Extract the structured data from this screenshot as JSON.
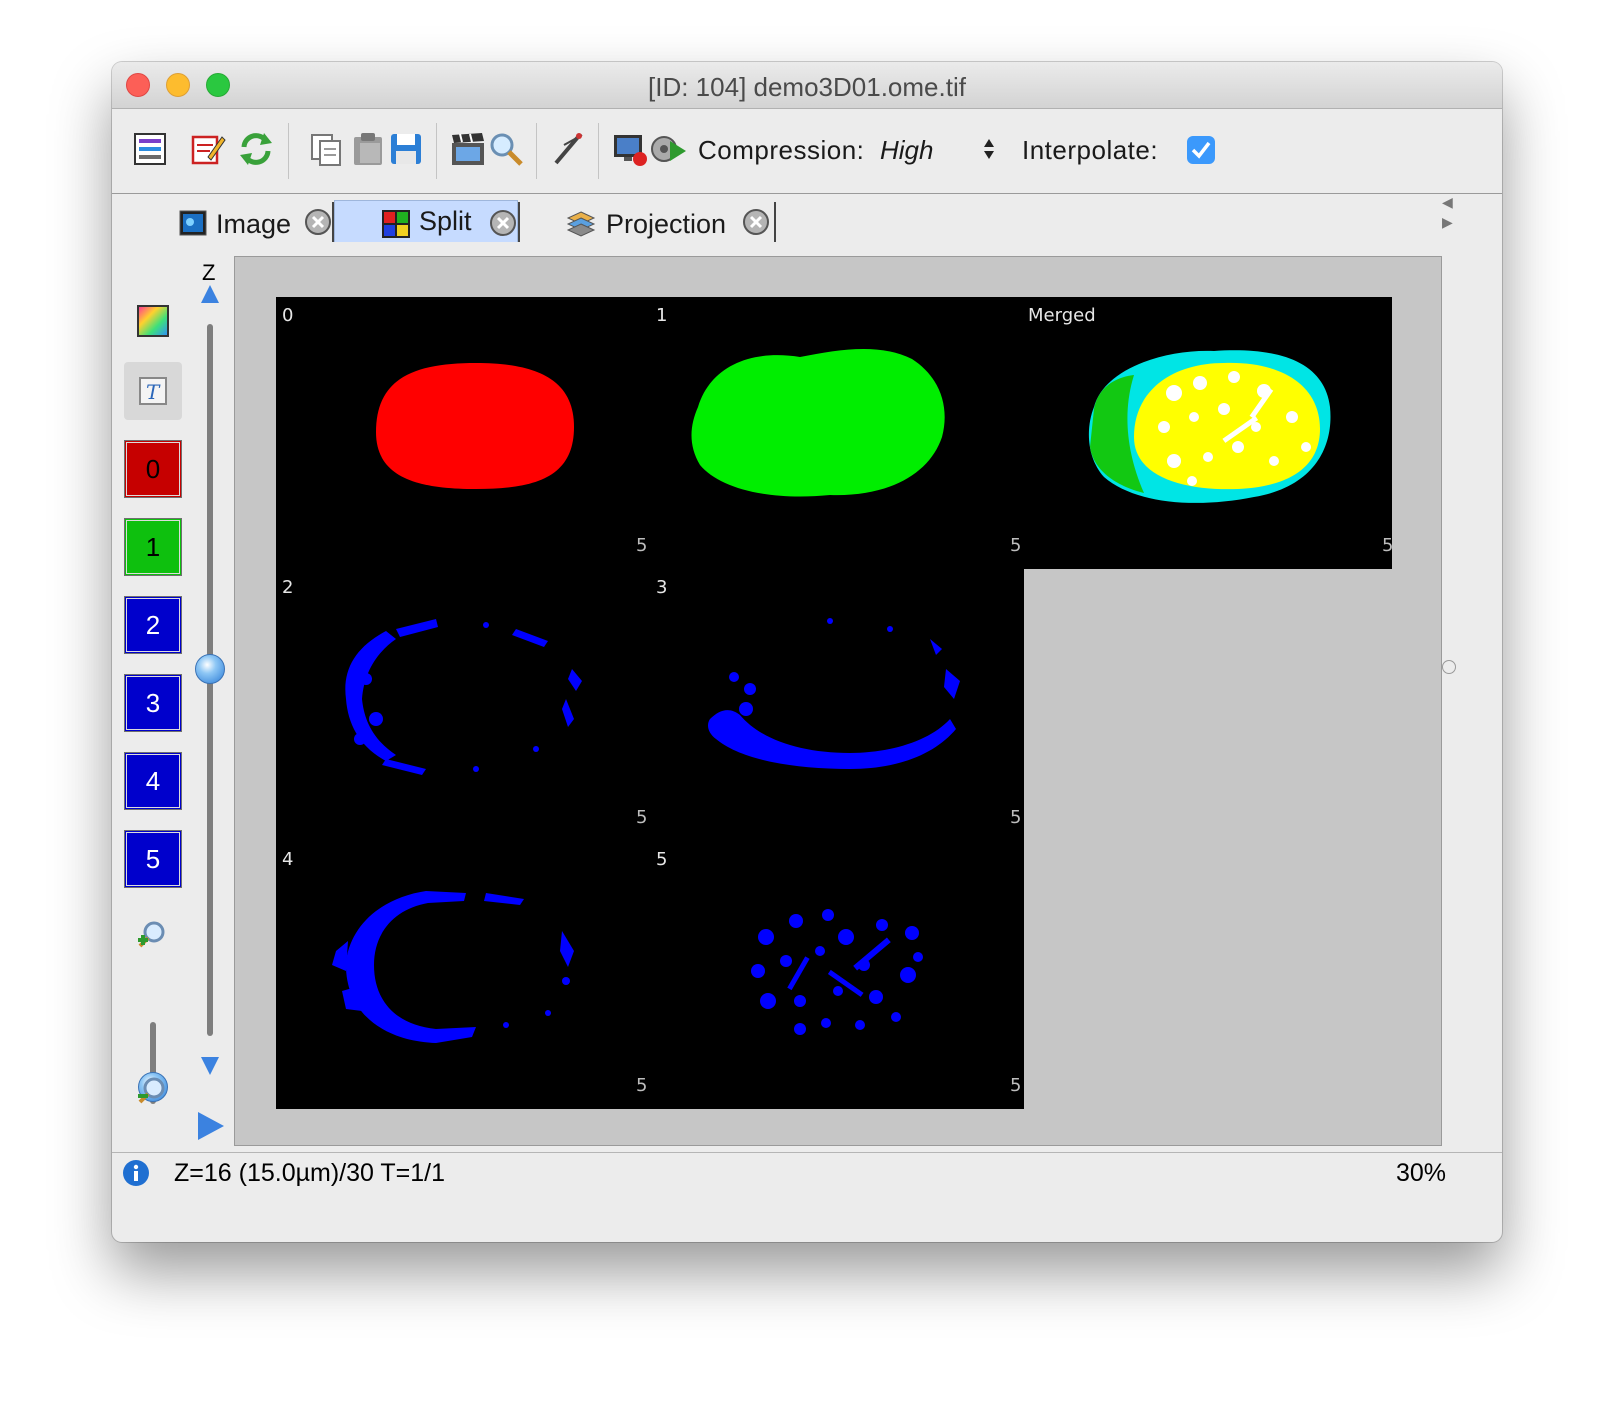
{
  "window": {
    "title": "[ID: 104] demo3D01.ome.tif"
  },
  "toolbar": {
    "compression_label": "Compression:",
    "compression_value": "High",
    "interpolate_label": "Interpolate:",
    "interpolate_checked": true
  },
  "tabs": [
    {
      "label": "Image",
      "icon": "image-icon",
      "active": false
    },
    {
      "label": "Split",
      "icon": "split-grid-icon",
      "active": true
    },
    {
      "label": "Projection",
      "icon": "projection-stack-icon",
      "active": false
    }
  ],
  "sidebar": {
    "z_label": "Z",
    "z_slider_value": "16/30",
    "zoom_slider_level": 0.3,
    "channels": [
      {
        "label": "0",
        "color": "#c60000"
      },
      {
        "label": "1",
        "color": "#0ec00e"
      },
      {
        "label": "2",
        "color": "#0000cc"
      },
      {
        "label": "3",
        "color": "#0000cc"
      },
      {
        "label": "4",
        "color": "#0000cc"
      },
      {
        "label": "5",
        "color": "#0000cc"
      }
    ]
  },
  "split_view": {
    "panels": [
      {
        "label": "0",
        "scale": "5",
        "color": "#ff0000"
      },
      {
        "label": "1",
        "scale": "5",
        "color": "#00ff00"
      },
      {
        "label": "Merged",
        "scale": "5",
        "color": "#ffff00"
      },
      {
        "label": "2",
        "scale": "5",
        "color": "#0000ff"
      },
      {
        "label": "3",
        "scale": "5",
        "color": "#0000ff"
      },
      {
        "label": "4",
        "scale": "5",
        "color": "#0000ff"
      },
      {
        "label": "5",
        "scale": "5",
        "color": "#0000ff"
      }
    ]
  },
  "status": {
    "position_text": "Z=16 (15.0µm)/30 T=1/1",
    "zoom_text": "30%"
  }
}
